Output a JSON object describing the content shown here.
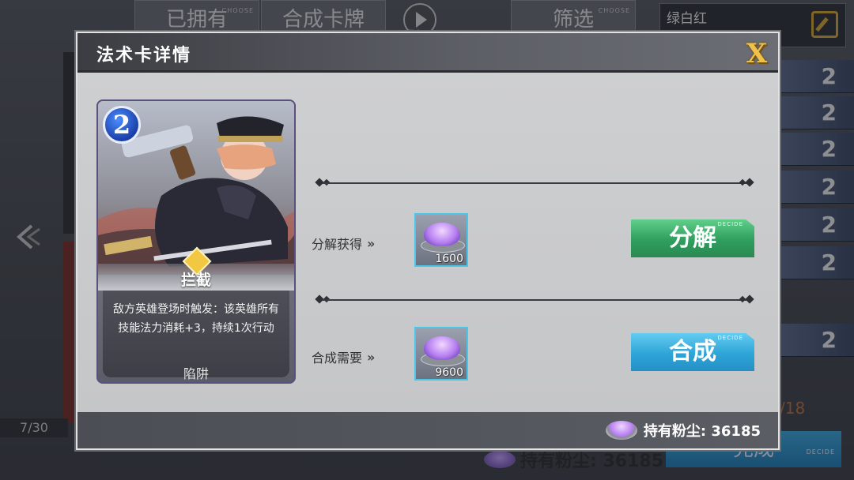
{
  "background": {
    "top_buttons": [
      {
        "label": "已拥有",
        "tag": "CHOOSE"
      },
      {
        "label": "合成卡牌",
        "tag": ""
      },
      {
        "label": "筛选",
        "tag": "CHOOSE"
      }
    ],
    "play_label": "开启",
    "deck_title": "绿白红",
    "deck_list_counts": [
      "2",
      "2",
      "2",
      "2",
      "2",
      "2",
      "2"
    ],
    "page_indicator": "7/30",
    "deck_count": "/18",
    "dust_text": "持有粉尘: 36185",
    "done_label": "完成",
    "done_tag": "DECIDE"
  },
  "modal": {
    "title": "法术卡详情",
    "close_label": "X",
    "card": {
      "cost": "2",
      "name": "拦截",
      "description": "敌方英雄登场时触发：该英雄所有技能法力消耗+3，持续1次行动",
      "type": "陷阱"
    },
    "decompose": {
      "label": "分解获得",
      "chevrons": "»",
      "amount": "1600",
      "button_label": "分解",
      "button_tag": "DECIDE"
    },
    "compose": {
      "label": "合成需要",
      "chevrons": "»",
      "amount": "9600",
      "button_label": "合成",
      "button_tag": "DECIDE"
    },
    "footer": {
      "dust_label": "持有粉尘: 36185"
    }
  },
  "colors": {
    "decompose_button": "#2f9e5e",
    "compose_button": "#2ea4d8",
    "close_icon": "#f0c148",
    "dust_tile_border": "#4cc6e8"
  }
}
